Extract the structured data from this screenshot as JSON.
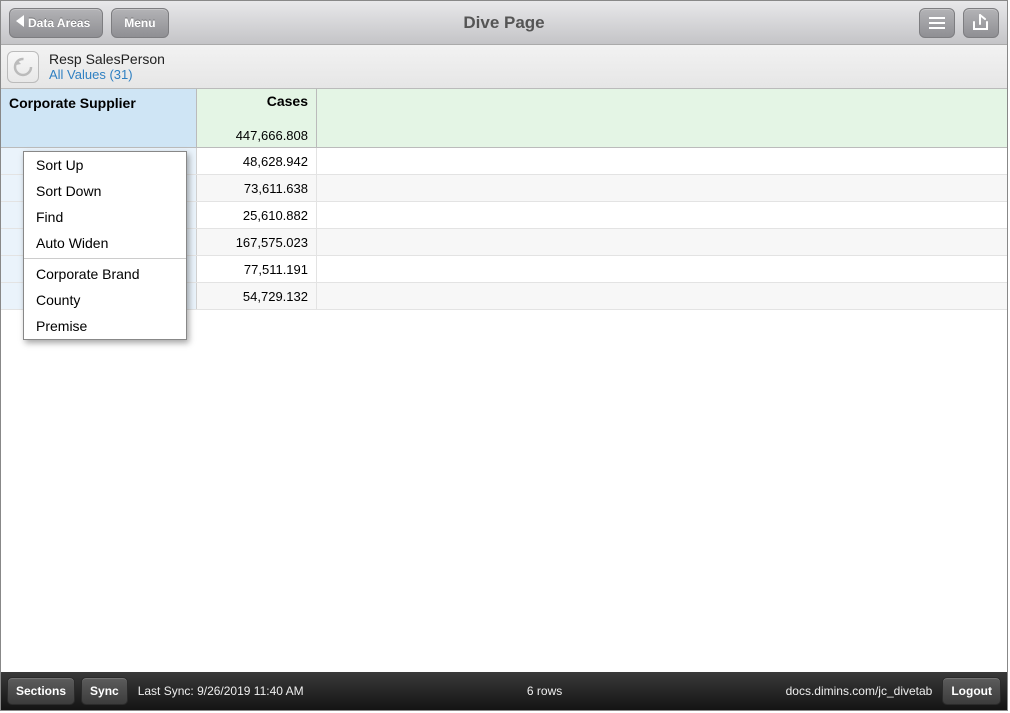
{
  "toolbar": {
    "back_label": "Data Areas",
    "menu_label": "Menu",
    "title": "Dive Page"
  },
  "breadcrumb": {
    "dimension": "Resp SalesPerson",
    "filter": "All Values (31)"
  },
  "grid": {
    "dim_header": "Corporate Supplier",
    "columns": [
      {
        "label": "Cases",
        "total": "447,666.808"
      }
    ],
    "rows": [
      {
        "measures": [
          "48,628.942"
        ]
      },
      {
        "measures": [
          "73,611.638"
        ]
      },
      {
        "measures": [
          "25,610.882"
        ]
      },
      {
        "measures": [
          "167,575.023"
        ]
      },
      {
        "measures": [
          "77,511.191"
        ]
      },
      {
        "measures": [
          "54,729.132"
        ]
      }
    ]
  },
  "context_menu": {
    "group1": [
      "Sort Up",
      "Sort Down",
      "Find",
      "Auto Widen"
    ],
    "group2": [
      "Corporate Brand",
      "County",
      "Premise"
    ]
  },
  "statusbar": {
    "sections_label": "Sections",
    "sync_label": "Sync",
    "last_sync": "Last Sync: 9/26/2019 11:40 AM",
    "row_count": "6 rows",
    "host": "docs.dimins.com/jc_divetab",
    "logout_label": "Logout"
  }
}
